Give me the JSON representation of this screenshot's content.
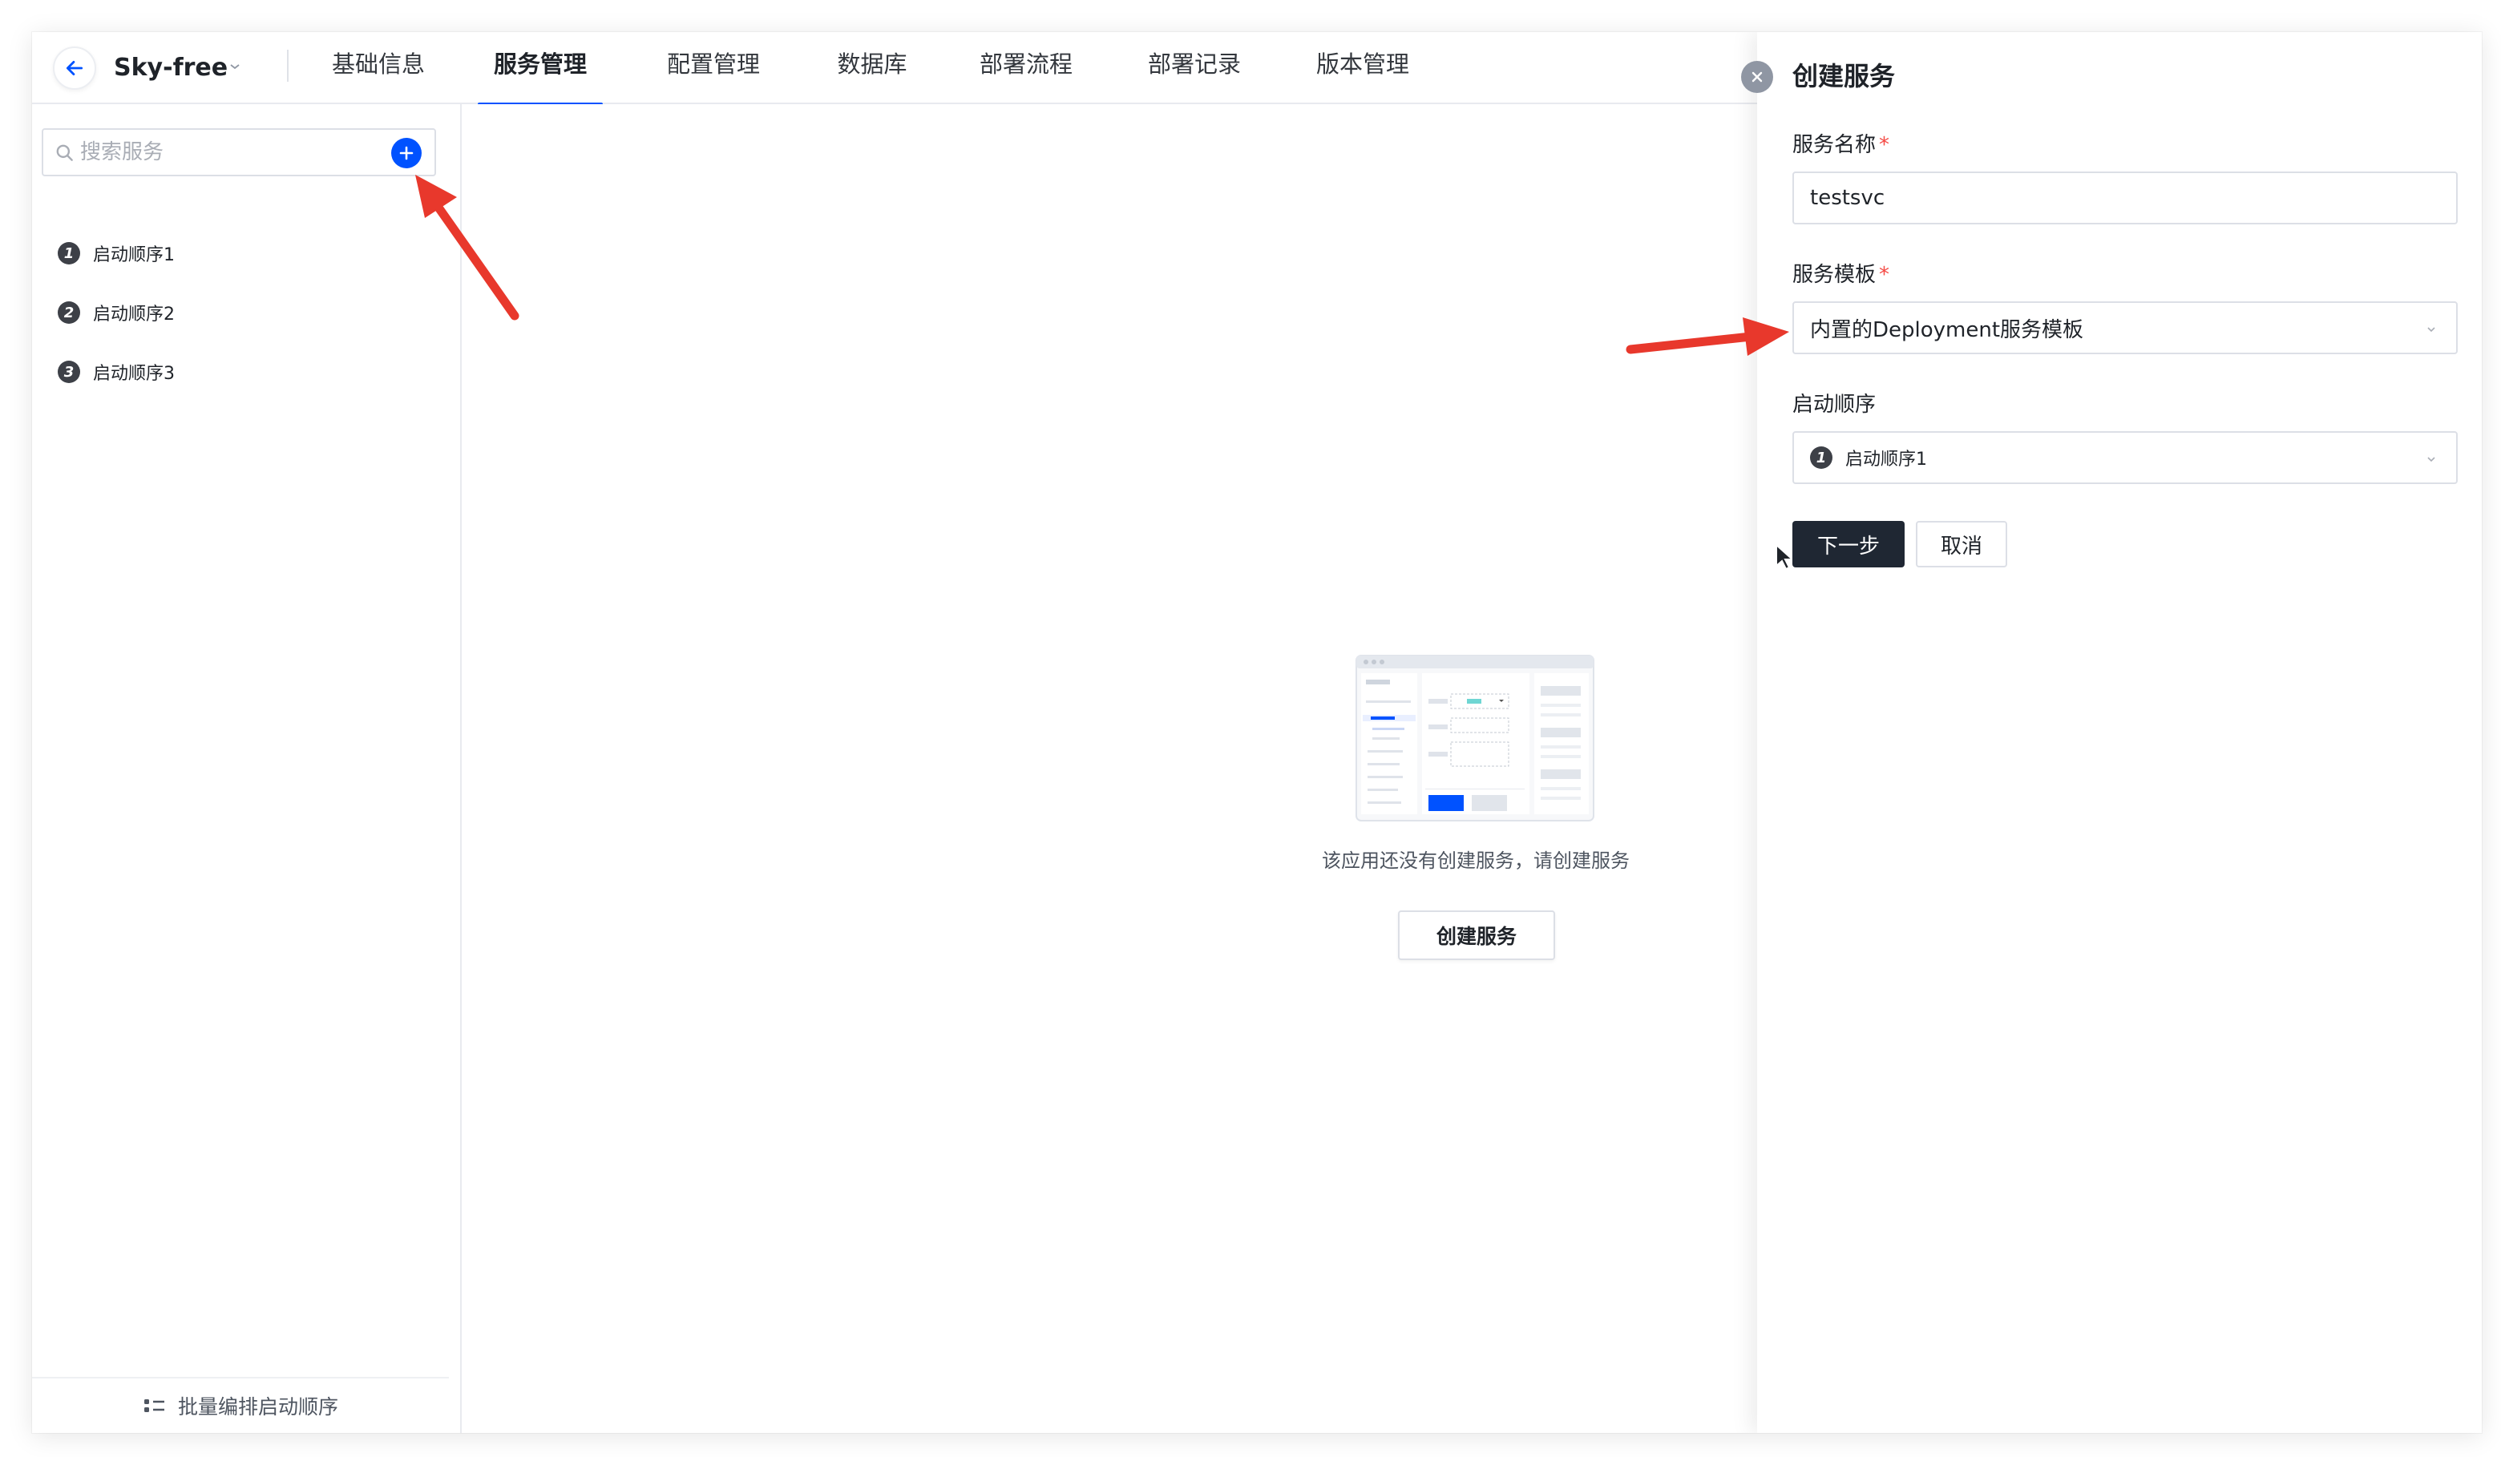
{
  "app": {
    "name": "Sky-free"
  },
  "nav": {
    "tabs": [
      {
        "label": "基础信息"
      },
      {
        "label": "服务管理"
      },
      {
        "label": "配置管理"
      },
      {
        "label": "数据库"
      },
      {
        "label": "部署流程"
      },
      {
        "label": "部署记录"
      },
      {
        "label": "版本管理"
      }
    ],
    "active_tab": "服务管理"
  },
  "sidebar": {
    "search": {
      "placeholder": "搜索服务"
    },
    "items": [
      {
        "num": "1",
        "label": "启动顺序1"
      },
      {
        "num": "2",
        "label": "启动顺序2"
      },
      {
        "num": "3",
        "label": "启动顺序3"
      }
    ],
    "footer_label": "批量编排启动顺序"
  },
  "main": {
    "empty_text": "该应用还没有创建服务，请创建服务",
    "create_button": "创建服务"
  },
  "drawer": {
    "title": "创建服务",
    "fields": {
      "name": {
        "label": "服务名称",
        "required": "*",
        "value": "testsvc"
      },
      "template": {
        "label": "服务模板",
        "required": "*",
        "value": "内置的Deployment服务模板"
      },
      "order": {
        "label": "启动顺序",
        "num": "1",
        "value": "启动顺序1"
      }
    },
    "next_button": "下一步",
    "cancel_button": "取消"
  },
  "colors": {
    "accent": "#0052ff",
    "primary_button": "#1f2733",
    "required": "#f54a45",
    "annotation_arrow": "#e8382c"
  }
}
